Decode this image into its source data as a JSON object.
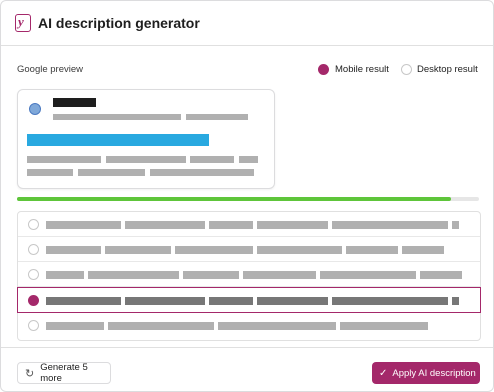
{
  "header": {
    "title": "AI description generator",
    "logo_icon": "yoast-logo-icon"
  },
  "preview": {
    "label": "Google preview",
    "mode_options": [
      {
        "label": "Mobile result",
        "selected": true
      },
      {
        "label": "Desktop result",
        "selected": false
      }
    ]
  },
  "progress": {
    "fraction": 0.94
  },
  "suggestions": {
    "count": 5,
    "selected_index": 3
  },
  "footer": {
    "generate_label": "Generate 5 more",
    "apply_label": "Apply AI description"
  },
  "colors": {
    "accent": "#a4286a",
    "progress": "#5ec53a",
    "link": "#29a9e0"
  }
}
